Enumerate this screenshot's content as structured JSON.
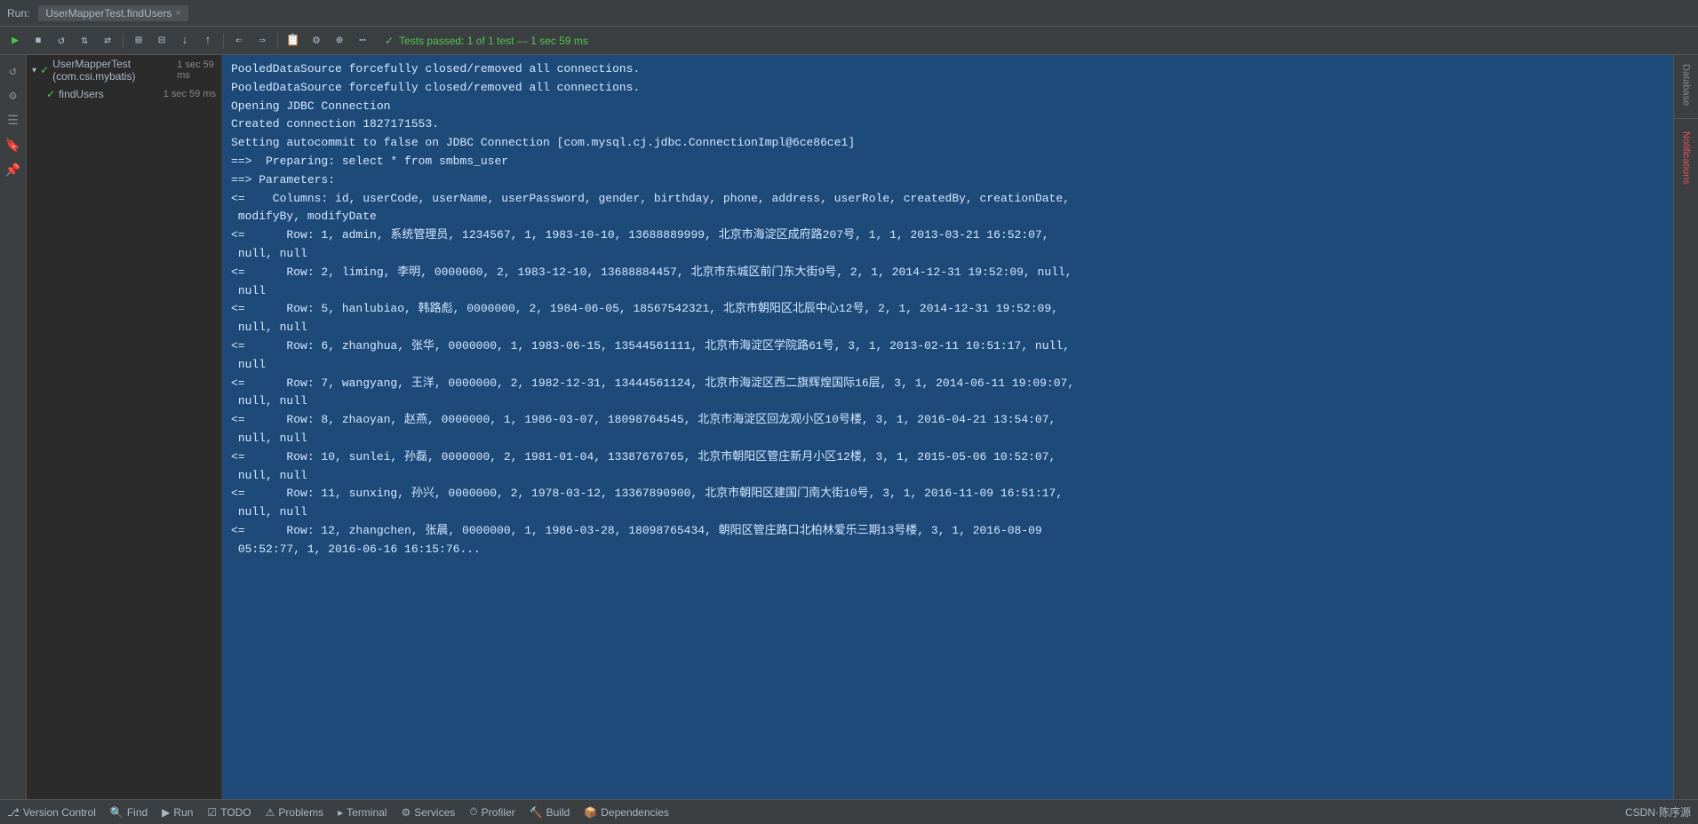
{
  "topbar": {
    "run_label": "Run:",
    "tab_label": "UserMapperTest.findUsers",
    "close_label": "×"
  },
  "run_toolbar": {
    "test_passed": "Tests passed: 1 of 1 test — 1 sec 59 ms",
    "checkmark": "✓",
    "buttons": [
      "▶",
      "⏹",
      "↺",
      "⇅",
      "⇄",
      "⊞",
      "⊟",
      "↓",
      "↑",
      "⇐",
      "⇒",
      "📋",
      "⚙",
      "⊕",
      "◉",
      "⋯"
    ]
  },
  "test_tree": {
    "items": [
      {
        "label": "UserMapperTest (com.csi.mybatis)",
        "time": "1 sec 59 ms",
        "level": 0,
        "status": "green"
      },
      {
        "label": "findUsers",
        "time": "1 sec 59 ms",
        "level": 1,
        "status": "green"
      }
    ]
  },
  "console": {
    "lines": [
      "PooledDataSource forcefully closed/removed all connections.",
      "PooledDataSource forcefully closed/removed all connections.",
      "Opening JDBC Connection",
      "Created connection 1827171553.",
      "Setting autocommit to false on JDBC Connection [com.mysql.cj.jdbc.ConnectionImpl@6ce86ce1]",
      "==>  Preparing: select * from smbms_user",
      "==> Parameters: ",
      "<=    Columns: id, userCode, userName, userPassword, gender, birthday, phone, address, userRole, createdBy, creationDate,\n modifyBy, modifyDate",
      "<=      Row: 1, admin, 系统管理员, 1234567, 1, 1983-10-10, 13688889999, 北京市海淀区成府路207号, 1, 1, 2013-03-21 16:52:07,\n null, null",
      "<=      Row: 2, liming, 李明, 0000000, 2, 1983-12-10, 13688884457, 北京市东城区前门东大街9号, 2, 1, 2014-12-31 19:52:09, null,\n null",
      "<=      Row: 5, hanlubiao, 韩路彪, 0000000, 2, 1984-06-05, 18567542321, 北京市朝阳区北辰中心12号, 2, 1, 2014-12-31 19:52:09,\n null, null",
      "<=      Row: 6, zhanghua, 张华, 0000000, 1, 1983-06-15, 13544561111, 北京市海淀区学院路61号, 3, 1, 2013-02-11 10:51:17, null,\n null",
      "<=      Row: 7, wangyang, 王洋, 0000000, 2, 1982-12-31, 13444561124, 北京市海淀区西二旗辉煌国际16层, 3, 1, 2014-06-11 19:09:07,\n null, null",
      "<=      Row: 8, zhaoyan, 赵燕, 0000000, 1, 1986-03-07, 18098764545, 北京市海淀区回龙观小区10号楼, 3, 1, 2016-04-21 13:54:07,\n null, null",
      "<=      Row: 10, sunlei, 孙磊, 0000000, 2, 1981-01-04, 13387676765, 北京市朝阳区管庄新月小区12楼, 3, 1, 2015-05-06 10:52:07,\n null, null",
      "<=      Row: 11, sunxing, 孙兴, 0000000, 2, 1978-03-12, 13367890900, 北京市朝阳区建国门南大街10号, 3, 1, 2016-11-09 16:51:17,\n null, null",
      "<=      Row: 12, zhangchen, 张晨, 0000000, 1, 1986-03-28, 18098765434, 朝阳区管庄路口北柏林爱乐三期13号楼, 3, 1, 2016-08-09\n 05:52:77, 1, 2016-06-16 16:15:76..."
    ]
  },
  "statusbar": {
    "items": [
      {
        "icon": "⎇",
        "label": "Version Control"
      },
      {
        "icon": "🔍",
        "label": "Find"
      },
      {
        "icon": "▶",
        "label": "Run"
      },
      {
        "icon": "☑",
        "label": "TODO"
      },
      {
        "icon": "⚠",
        "label": "Problems"
      },
      {
        "icon": "▸",
        "label": "Terminal"
      },
      {
        "icon": "⚙",
        "label": "Services"
      },
      {
        "icon": "⏱",
        "label": "Profiler"
      },
      {
        "icon": "🔨",
        "label": "Build"
      },
      {
        "icon": "📦",
        "label": "Dependencies"
      }
    ],
    "right_label": "CSDN·陈序源"
  },
  "right_panel": {
    "labels": [
      "Database",
      "Notifications"
    ]
  }
}
